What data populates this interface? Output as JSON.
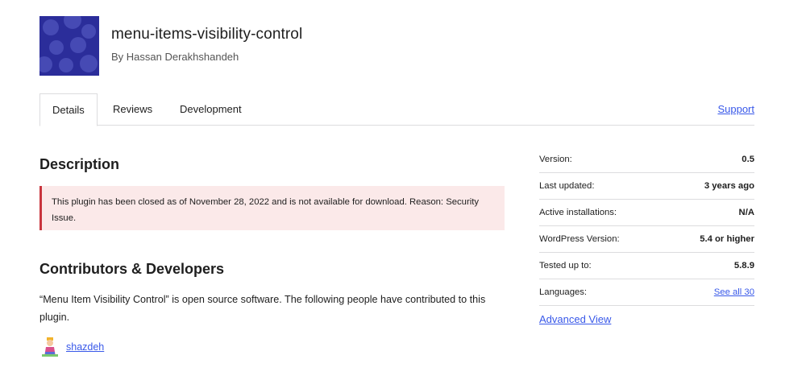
{
  "plugin": {
    "title": "menu-items-visibility-control",
    "author": "By Hassan Derakhshandeh"
  },
  "tabs": [
    {
      "label": "Details",
      "active": true
    },
    {
      "label": "Reviews",
      "active": false
    },
    {
      "label": "Development",
      "active": false
    }
  ],
  "support_label": "Support",
  "description": {
    "heading": "Description",
    "notice": "This plugin has been closed as of November 28, 2022 and is not available for download. Reason: Security Issue."
  },
  "contributors": {
    "heading": "Contributors & Developers",
    "text": "“Menu Item Visibility Control” is open source software. The following people have contributed to this plugin.",
    "people": [
      {
        "name": "shazdeh"
      }
    ]
  },
  "meta": {
    "rows": [
      {
        "label": "Version:",
        "value": "0.5"
      },
      {
        "label": "Last updated:",
        "value": "3 years ago"
      },
      {
        "label": "Active installations:",
        "value": "N/A"
      },
      {
        "label": "WordPress Version:",
        "value": "5.4 or higher"
      },
      {
        "label": "Tested up to:",
        "value": "5.8.9"
      },
      {
        "label": "Languages:",
        "value": "See all 30"
      }
    ],
    "advanced_view": "Advanced View"
  },
  "colors": {
    "link": "#3858e9",
    "notice_bg": "#fbe9e9",
    "notice_border": "#c9353e",
    "icon_bg": "#2b2d9a"
  }
}
